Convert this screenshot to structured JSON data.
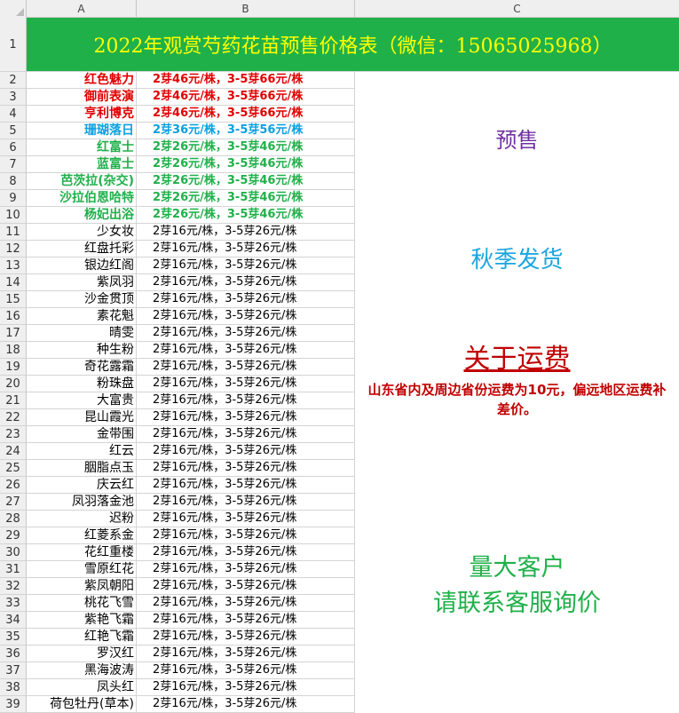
{
  "columns": [
    "A",
    "B",
    "C"
  ],
  "title": "2022年观赏芍药花苗预售价格表（微信：15065025968）",
  "rows": [
    {
      "num": "2",
      "name": "红色魅力",
      "price": "2芽46元/株，3-5芽66元/株",
      "style": "red"
    },
    {
      "num": "3",
      "name": "御前表演",
      "price": "2芽46元/株，3-5芽66元/株",
      "style": "red"
    },
    {
      "num": "4",
      "name": "亨利博克",
      "price": "2芽46元/株，3-5芽66元/株",
      "style": "red"
    },
    {
      "num": "5",
      "name": "珊瑚落日",
      "price": "2芽36元/株，3-5芽56元/株",
      "style": "blue"
    },
    {
      "num": "6",
      "name": "红富士",
      "price": "2芽26元/株，3-5芽46元/株",
      "style": "green"
    },
    {
      "num": "7",
      "name": "蓝富士",
      "price": "2芽26元/株，3-5芽46元/株",
      "style": "green"
    },
    {
      "num": "8",
      "name": "芭茨拉(杂交)",
      "price": "2芽26元/株，3-5芽46元/株",
      "style": "green"
    },
    {
      "num": "9",
      "name": "沙拉伯恩哈特",
      "price": "2芽26元/株，3-5芽46元/株",
      "style": "green"
    },
    {
      "num": "10",
      "name": "杨妃出浴",
      "price": "2芽26元/株，3-5芽46元/株",
      "style": "green"
    },
    {
      "num": "11",
      "name": "少女妆",
      "price": "2芽16元/株，3-5芽26元/株",
      "style": "plain"
    },
    {
      "num": "12",
      "name": "红盘托彩",
      "price": "2芽16元/株，3-5芽26元/株",
      "style": "plain"
    },
    {
      "num": "13",
      "name": "银边红阁",
      "price": "2芽16元/株，3-5芽26元/株",
      "style": "plain"
    },
    {
      "num": "14",
      "name": "紫凤羽",
      "price": "2芽16元/株，3-5芽26元/株",
      "style": "plain"
    },
    {
      "num": "15",
      "name": "沙金贯顶",
      "price": "2芽16元/株，3-5芽26元/株",
      "style": "plain"
    },
    {
      "num": "16",
      "name": "素花魁",
      "price": "2芽16元/株，3-5芽26元/株",
      "style": "plain"
    },
    {
      "num": "17",
      "name": "晴雯",
      "price": "2芽16元/株，3-5芽26元/株",
      "style": "plain"
    },
    {
      "num": "18",
      "name": "种生粉",
      "price": "2芽16元/株，3-5芽26元/株",
      "style": "plain"
    },
    {
      "num": "19",
      "name": "奇花露霜",
      "price": "2芽16元/株，3-5芽26元/株",
      "style": "plain"
    },
    {
      "num": "20",
      "name": "粉珠盘",
      "price": "2芽16元/株，3-5芽26元/株",
      "style": "plain"
    },
    {
      "num": "21",
      "name": "大富贵",
      "price": "2芽16元/株，3-5芽26元/株",
      "style": "plain"
    },
    {
      "num": "22",
      "name": "昆山霞光",
      "price": "2芽16元/株，3-5芽26元/株",
      "style": "plain"
    },
    {
      "num": "23",
      "name": "金带围",
      "price": "2芽16元/株，3-5芽26元/株",
      "style": "plain"
    },
    {
      "num": "24",
      "name": "红云",
      "price": "2芽16元/株，3-5芽26元/株",
      "style": "plain"
    },
    {
      "num": "25",
      "name": "胭脂点玉",
      "price": "2芽16元/株，3-5芽26元/株",
      "style": "plain"
    },
    {
      "num": "26",
      "name": "庆云红",
      "price": "2芽16元/株，3-5芽26元/株",
      "style": "plain"
    },
    {
      "num": "27",
      "name": "凤羽落金池",
      "price": "2芽16元/株，3-5芽26元/株",
      "style": "plain"
    },
    {
      "num": "28",
      "name": "迟粉",
      "price": "2芽16元/株，3-5芽26元/株",
      "style": "plain"
    },
    {
      "num": "29",
      "name": "红菱系金",
      "price": "2芽16元/株，3-5芽26元/株",
      "style": "plain"
    },
    {
      "num": "30",
      "name": "花红重楼",
      "price": "2芽16元/株，3-5芽26元/株",
      "style": "plain"
    },
    {
      "num": "31",
      "name": "雪原红花",
      "price": "2芽16元/株，3-5芽26元/株",
      "style": "plain"
    },
    {
      "num": "32",
      "name": "紫凤朝阳",
      "price": "2芽16元/株，3-5芽26元/株",
      "style": "plain"
    },
    {
      "num": "33",
      "name": "桃花飞雪",
      "price": "2芽16元/株，3-5芽26元/株",
      "style": "plain"
    },
    {
      "num": "34",
      "name": "紫艳飞霜",
      "price": "2芽16元/株，3-5芽26元/株",
      "style": "plain"
    },
    {
      "num": "35",
      "name": "红艳飞霜",
      "price": "2芽16元/株，3-5芽26元/株",
      "style": "plain"
    },
    {
      "num": "36",
      "name": "罗汉红",
      "price": "2芽16元/株，3-5芽26元/株",
      "style": "plain"
    },
    {
      "num": "37",
      "name": "黑海波涛",
      "price": "2芽16元/株，3-5芽26元/株",
      "style": "plain"
    },
    {
      "num": "38",
      "name": "凤头红",
      "price": "2芽16元/株，3-5芽26元/株",
      "style": "plain"
    },
    {
      "num": "39",
      "name": "荷包牡丹(草本)",
      "price": "2芽16元/株，3-5芽26元/株",
      "style": "plain"
    }
  ],
  "notes": {
    "presale": "预售",
    "autumn": "秋季发货",
    "shipping_title": "关于运费",
    "shipping_text": "山东省内及周边省份运费为10元，偏远地区运费补差价。",
    "bulk_line1": "量大客户",
    "bulk_line2": "请联系客服询价"
  },
  "colors": {
    "title_bg": "#20b04a",
    "title_text": "#ffff00",
    "red": "#e00000",
    "blue": "#0aa0e0",
    "green": "#20b04a",
    "purple": "#7030a0",
    "dark_red": "#c00000"
  }
}
